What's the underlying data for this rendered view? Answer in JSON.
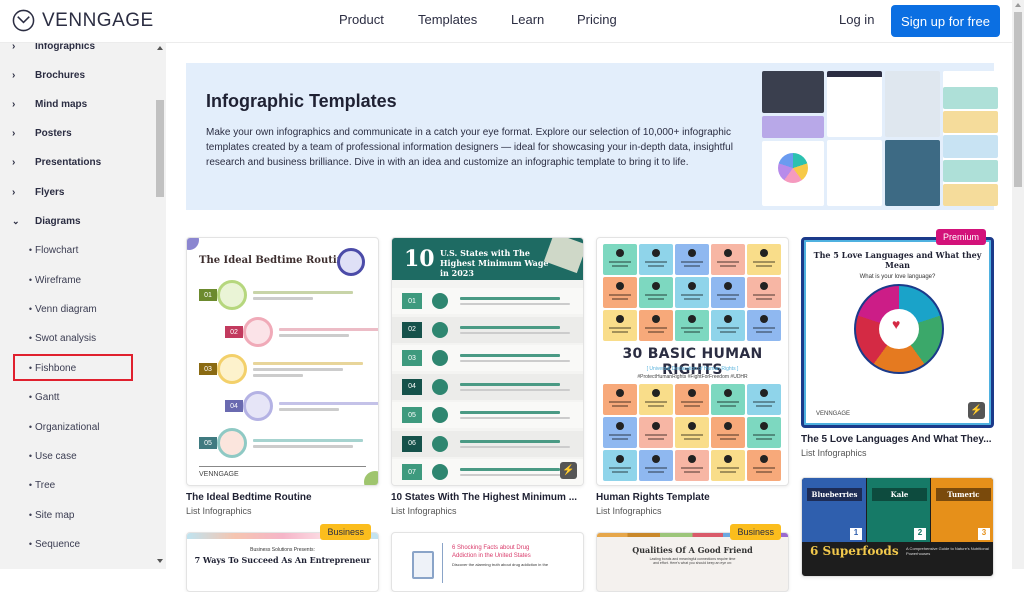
{
  "header": {
    "logo_text": "VENNGAGE",
    "nav": [
      "Product",
      "Templates",
      "Learn",
      "Pricing"
    ],
    "login": "Log in",
    "signup": "Sign up for free"
  },
  "sidebar": {
    "categories": [
      {
        "label": "Infographics",
        "expanded": false
      },
      {
        "label": "Brochures",
        "expanded": false
      },
      {
        "label": "Mind maps",
        "expanded": false
      },
      {
        "label": "Posters",
        "expanded": false
      },
      {
        "label": "Presentations",
        "expanded": false
      },
      {
        "label": "Flyers",
        "expanded": false
      },
      {
        "label": "Diagrams",
        "expanded": true
      }
    ],
    "diagram_items": [
      "Flowchart",
      "Wireframe",
      "Venn diagram",
      "Swot analysis",
      "Fishbone",
      "Gantt",
      "Organizational",
      "Use case",
      "Tree",
      "Site map",
      "Sequence"
    ],
    "highlighted_item": "Fishbone"
  },
  "hero": {
    "title": "Infographic Templates",
    "description": "Make your own infographics and communicate in a catch your eye format. Explore our selection of 10,000+ infographic templates created by a team of professional information designers — ideal for showcasing your in-depth data, insightful research and business brilliance. Dive in with an idea and customize an infographic template to bring it to life."
  },
  "cards": [
    {
      "title": "The Ideal Bedtime Routine",
      "category": "List Infographics",
      "thumb_title": "The Ideal Bedtime Routine",
      "steps": [
        "01",
        "02",
        "03",
        "04",
        "05"
      ],
      "footer_logo": "VENNGAGE"
    },
    {
      "title": "10 States With The Highest Minimum ...",
      "category": "List Infographics",
      "thumb_number": "10",
      "thumb_title": "U.S. States with The Highest Minimum Wage in 2023",
      "steps": [
        "01",
        "02",
        "03",
        "04",
        "05",
        "06",
        "07"
      ]
    },
    {
      "title": "Human Rights Template",
      "category": "List Infographics",
      "thumb_title": "30 BASIC HUMAN RIGHTS",
      "thumb_subtitle": "[ Universal Declaration of Human Rights ]",
      "thumb_tags": "#ProtectHumanRights #FightForFreedom #UDHR"
    },
    {
      "title": "The 5 Love Languages And What They...",
      "category": "List Infographics",
      "badge": "Premium",
      "thumb_title": "The 5 Love Languages and What they Mean",
      "thumb_subtitle": "What is your love language?",
      "footer_logo": "VENNGAGE"
    },
    {
      "badge": "Business",
      "thumb_pre": "Business Solutions Presents:",
      "thumb_title": "7 Ways To Succeed As An Entrepreneur"
    },
    {
      "thumb_title": "6 Shocking Facts about Drug Addiction in the United States",
      "thumb_subtitle": "Discover the alarming truth about drug addiction in the"
    },
    {
      "badge": "Business",
      "thumb_title": "Qualities Of A Good Friend",
      "thumb_subtitle": "Lasting bonds and meaningful connections require time and effort. Here's what you should keep an eye on:"
    },
    {
      "thumb_items": [
        "Blueberries",
        "Kale",
        "Tumeric"
      ],
      "thumb_numbers": [
        "1",
        "2",
        "3"
      ],
      "thumb_title": "6 Superfoods",
      "thumb_subtitle": "A Comprehensive Guide to Nature's Nutritional Powerhouses"
    }
  ],
  "colors": {
    "accent": "#0b6fe2",
    "premium": "#d3127a",
    "business": "#fbbd1d",
    "highlight_box": "#e0202e",
    "hero_bg": "#e3eefb"
  }
}
